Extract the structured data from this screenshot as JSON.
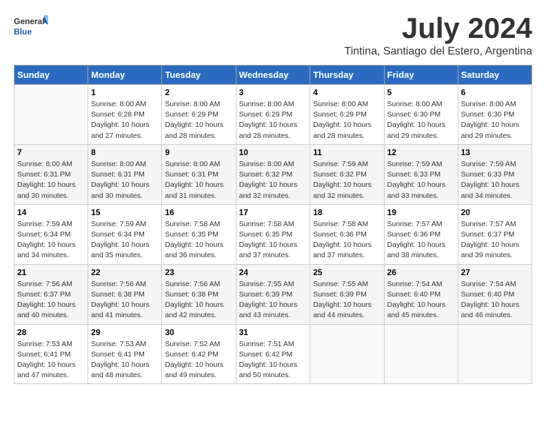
{
  "header": {
    "logo": {
      "general": "General",
      "blue": "Blue"
    },
    "title": "July 2024",
    "location": "Tintina, Santiago del Estero, Argentina"
  },
  "days_of_week": [
    "Sunday",
    "Monday",
    "Tuesday",
    "Wednesday",
    "Thursday",
    "Friday",
    "Saturday"
  ],
  "weeks": [
    [
      {
        "day": "",
        "info": ""
      },
      {
        "day": "1",
        "info": "Sunrise: 8:00 AM\nSunset: 6:28 PM\nDaylight: 10 hours\nand 27 minutes."
      },
      {
        "day": "2",
        "info": "Sunrise: 8:00 AM\nSunset: 6:29 PM\nDaylight: 10 hours\nand 28 minutes."
      },
      {
        "day": "3",
        "info": "Sunrise: 8:00 AM\nSunset: 6:29 PM\nDaylight: 10 hours\nand 28 minutes."
      },
      {
        "day": "4",
        "info": "Sunrise: 8:00 AM\nSunset: 6:29 PM\nDaylight: 10 hours\nand 28 minutes."
      },
      {
        "day": "5",
        "info": "Sunrise: 8:00 AM\nSunset: 6:30 PM\nDaylight: 10 hours\nand 29 minutes."
      },
      {
        "day": "6",
        "info": "Sunrise: 8:00 AM\nSunset: 6:30 PM\nDaylight: 10 hours\nand 29 minutes."
      }
    ],
    [
      {
        "day": "7",
        "info": "Sunrise: 8:00 AM\nSunset: 6:31 PM\nDaylight: 10 hours\nand 30 minutes."
      },
      {
        "day": "8",
        "info": "Sunrise: 8:00 AM\nSunset: 6:31 PM\nDaylight: 10 hours\nand 30 minutes."
      },
      {
        "day": "9",
        "info": "Sunrise: 8:00 AM\nSunset: 6:31 PM\nDaylight: 10 hours\nand 31 minutes."
      },
      {
        "day": "10",
        "info": "Sunrise: 8:00 AM\nSunset: 6:32 PM\nDaylight: 10 hours\nand 32 minutes."
      },
      {
        "day": "11",
        "info": "Sunrise: 7:59 AM\nSunset: 6:32 PM\nDaylight: 10 hours\nand 32 minutes."
      },
      {
        "day": "12",
        "info": "Sunrise: 7:59 AM\nSunset: 6:33 PM\nDaylight: 10 hours\nand 33 minutes."
      },
      {
        "day": "13",
        "info": "Sunrise: 7:59 AM\nSunset: 6:33 PM\nDaylight: 10 hours\nand 34 minutes."
      }
    ],
    [
      {
        "day": "14",
        "info": "Sunrise: 7:59 AM\nSunset: 6:34 PM\nDaylight: 10 hours\nand 34 minutes."
      },
      {
        "day": "15",
        "info": "Sunrise: 7:59 AM\nSunset: 6:34 PM\nDaylight: 10 hours\nand 35 minutes."
      },
      {
        "day": "16",
        "info": "Sunrise: 7:58 AM\nSunset: 6:35 PM\nDaylight: 10 hours\nand 36 minutes."
      },
      {
        "day": "17",
        "info": "Sunrise: 7:58 AM\nSunset: 6:35 PM\nDaylight: 10 hours\nand 37 minutes."
      },
      {
        "day": "18",
        "info": "Sunrise: 7:58 AM\nSunset: 6:36 PM\nDaylight: 10 hours\nand 37 minutes."
      },
      {
        "day": "19",
        "info": "Sunrise: 7:57 AM\nSunset: 6:36 PM\nDaylight: 10 hours\nand 38 minutes."
      },
      {
        "day": "20",
        "info": "Sunrise: 7:57 AM\nSunset: 6:37 PM\nDaylight: 10 hours\nand 39 minutes."
      }
    ],
    [
      {
        "day": "21",
        "info": "Sunrise: 7:56 AM\nSunset: 6:37 PM\nDaylight: 10 hours\nand 40 minutes."
      },
      {
        "day": "22",
        "info": "Sunrise: 7:56 AM\nSunset: 6:38 PM\nDaylight: 10 hours\nand 41 minutes."
      },
      {
        "day": "23",
        "info": "Sunrise: 7:56 AM\nSunset: 6:38 PM\nDaylight: 10 hours\nand 42 minutes."
      },
      {
        "day": "24",
        "info": "Sunrise: 7:55 AM\nSunset: 6:39 PM\nDaylight: 10 hours\nand 43 minutes."
      },
      {
        "day": "25",
        "info": "Sunrise: 7:55 AM\nSunset: 6:39 PM\nDaylight: 10 hours\nand 44 minutes."
      },
      {
        "day": "26",
        "info": "Sunrise: 7:54 AM\nSunset: 6:40 PM\nDaylight: 10 hours\nand 45 minutes."
      },
      {
        "day": "27",
        "info": "Sunrise: 7:54 AM\nSunset: 6:40 PM\nDaylight: 10 hours\nand 46 minutes."
      }
    ],
    [
      {
        "day": "28",
        "info": "Sunrise: 7:53 AM\nSunset: 6:41 PM\nDaylight: 10 hours\nand 47 minutes."
      },
      {
        "day": "29",
        "info": "Sunrise: 7:53 AM\nSunset: 6:41 PM\nDaylight: 10 hours\nand 48 minutes."
      },
      {
        "day": "30",
        "info": "Sunrise: 7:52 AM\nSunset: 6:42 PM\nDaylight: 10 hours\nand 49 minutes."
      },
      {
        "day": "31",
        "info": "Sunrise: 7:51 AM\nSunset: 6:42 PM\nDaylight: 10 hours\nand 50 minutes."
      },
      {
        "day": "",
        "info": ""
      },
      {
        "day": "",
        "info": ""
      },
      {
        "day": "",
        "info": ""
      }
    ]
  ]
}
